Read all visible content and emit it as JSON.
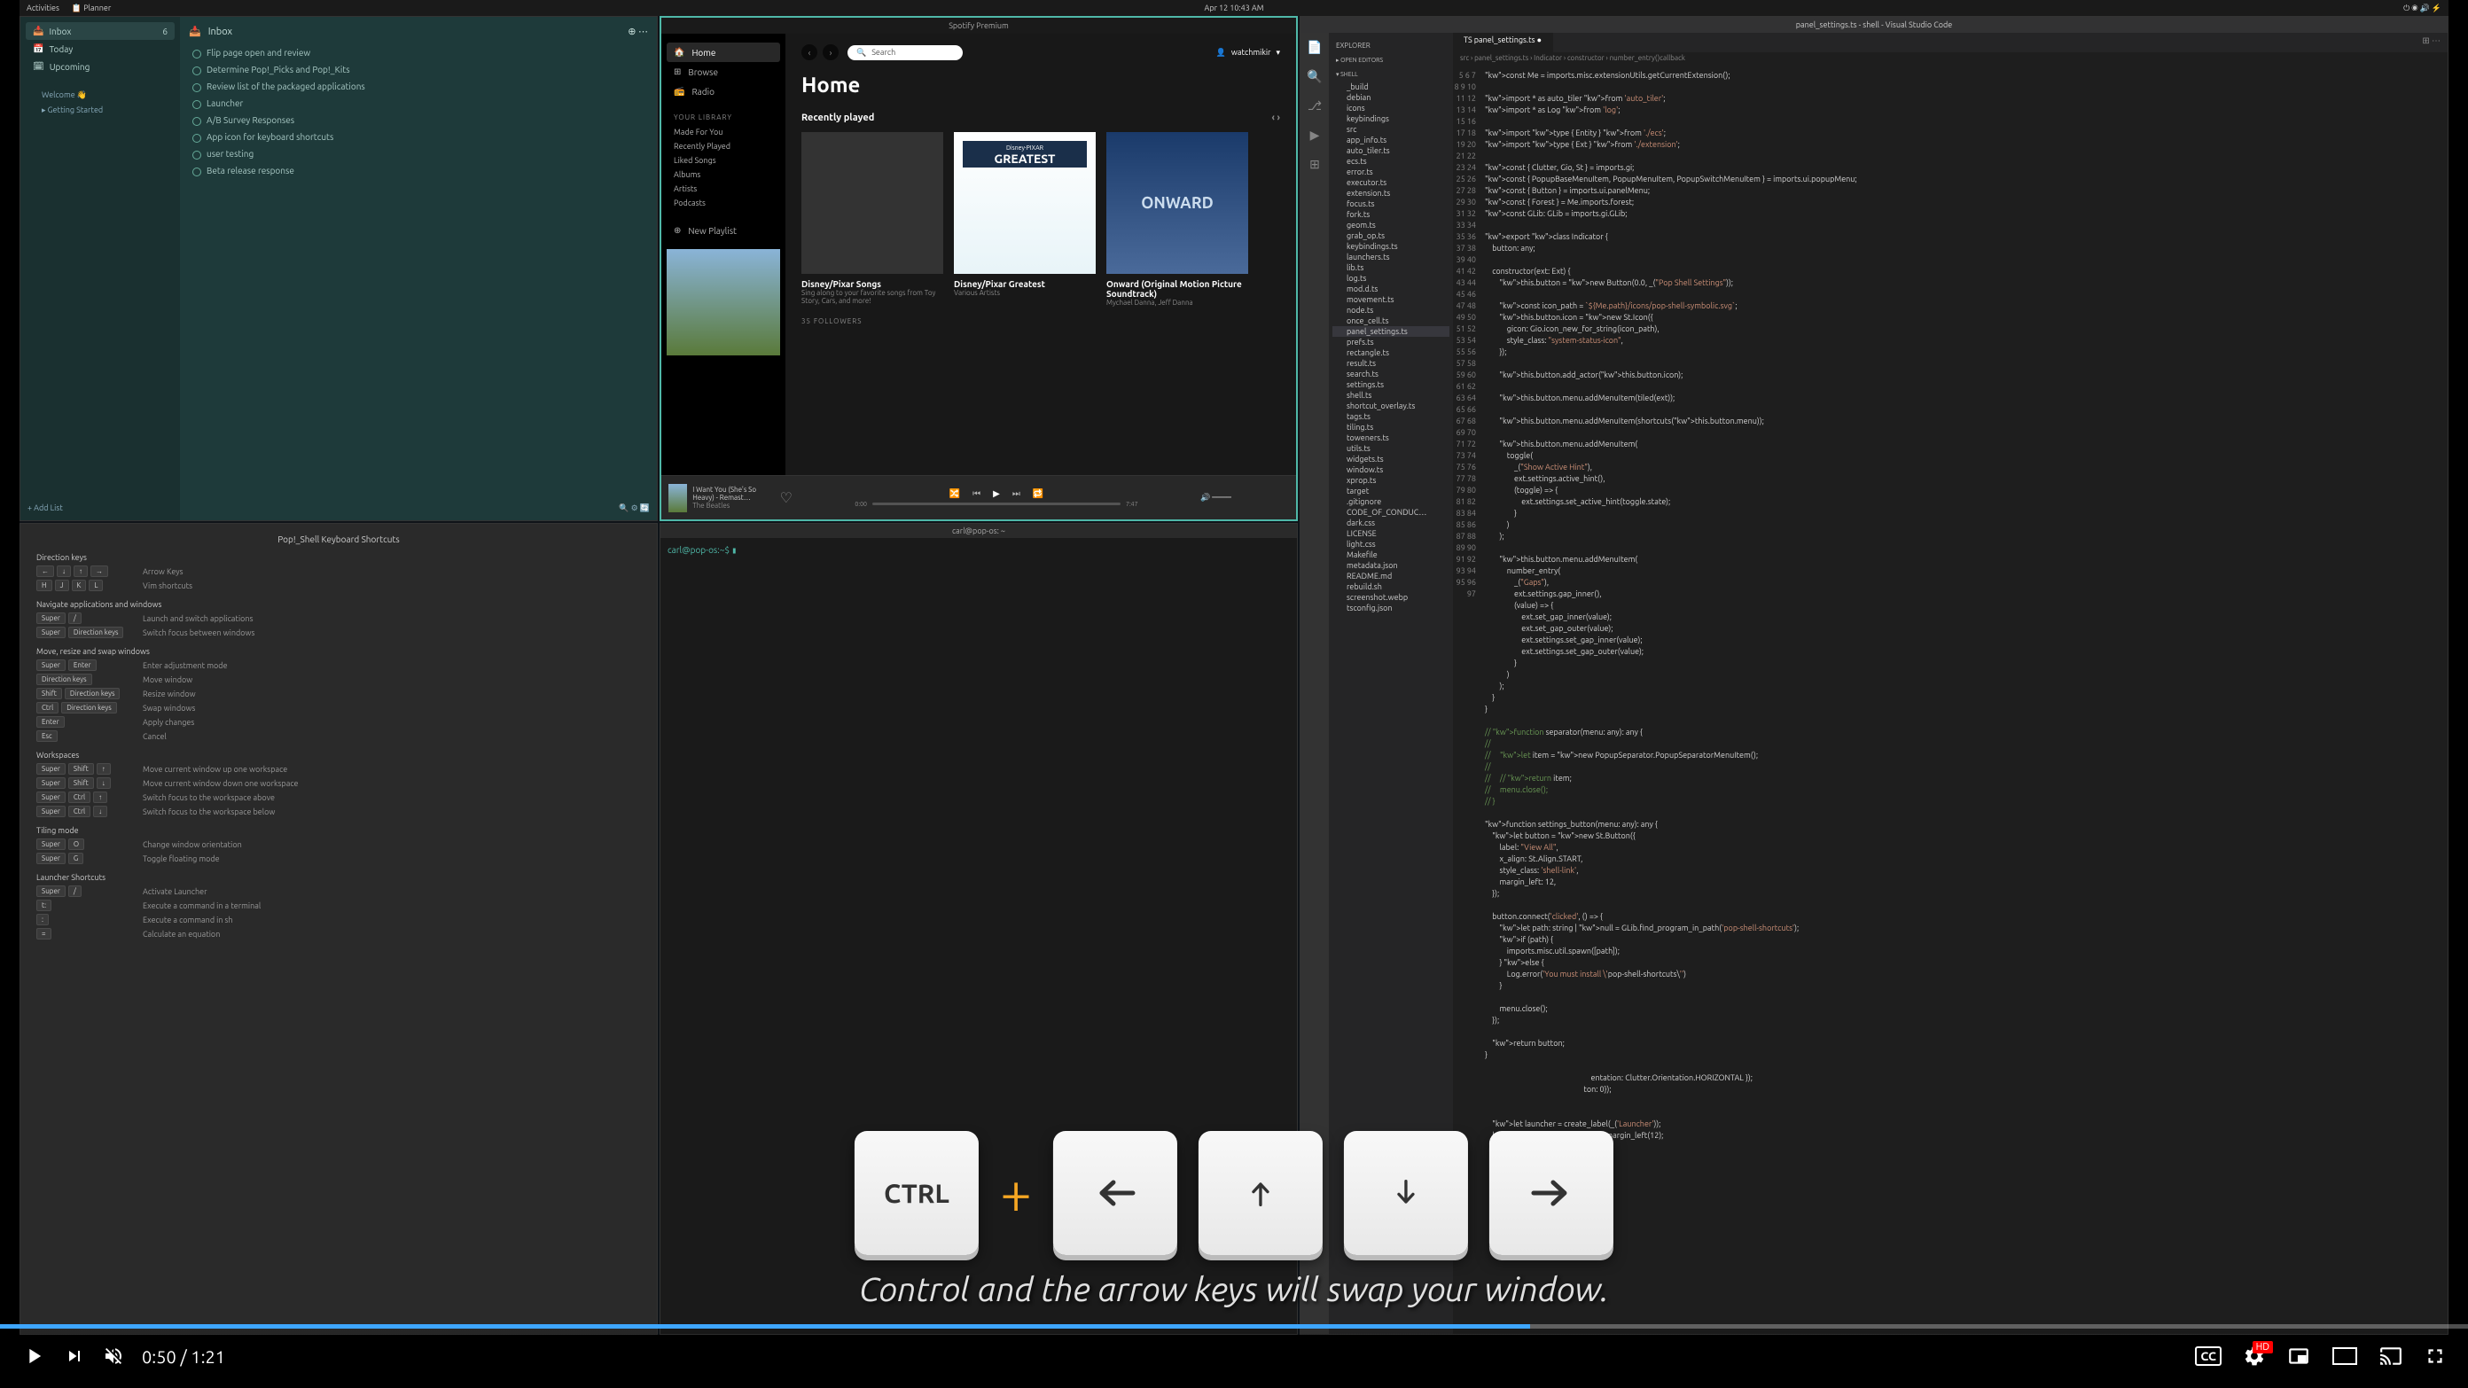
{
  "sysbar": {
    "activities": "Activities",
    "app": "Planner",
    "datetime": "Apr 12  10:43 AM"
  },
  "planner": {
    "sidebar": {
      "inbox": "Inbox",
      "inbox_count": "6",
      "today": "Today",
      "upcoming": "Upcoming",
      "projects_hdr": "",
      "projects": [
        "Welcome 👋",
        "Getting Started"
      ],
      "add": "+  Add List"
    },
    "header": "Inbox",
    "tasks": [
      "Flip page open and review",
      "Determine Pop!_Picks and Pop!_Kits",
      "Review list of the packaged applications",
      "Launcher",
      "A/B Survey Responses",
      "App icon for keyboard shortcuts",
      "user testing",
      "Beta release response"
    ]
  },
  "spotify": {
    "title": "Spotify Premium",
    "nav": {
      "home": "Home",
      "browse": "Browse",
      "radio": "Radio"
    },
    "search_placeholder": "Search",
    "user": "watchmikir",
    "library_hdr": "YOUR LIBRARY",
    "library": [
      "Made For You",
      "Recently Played",
      "Liked Songs",
      "Albums",
      "Artists",
      "Podcasts"
    ],
    "new_playlist": "New Playlist",
    "home_hdr": "Home",
    "recent_hdr": "Recently played",
    "cards": [
      {
        "title": "Disney/Pixar Songs",
        "desc": "Sing along to your favorite songs from Toy Story, Cars, and more!"
      },
      {
        "title": "Disney/Pixar Greatest",
        "desc": "Various Artists"
      },
      {
        "title": "Onward (Original Motion Picture Soundtrack)",
        "desc": "Mychael Danna, Jeff Danna"
      }
    ],
    "followers": "35 FOLLOWERS",
    "now_playing": {
      "track": "I Want You (She's So Heavy) - Remast…",
      "artist": "The Beatles"
    },
    "time_cur": "0:00",
    "time_tot": "7:47"
  },
  "vscode": {
    "title": "panel_settings.ts - shell - Visual Studio Code",
    "tab": "panel_settings.ts",
    "breadcrumb": "src › panel_settings.ts › Indicator › constructor › number_entry()callback",
    "explorer_hdr": "EXPLORER",
    "open_editors": "OPEN EDITORS",
    "root": "SHELL",
    "files": [
      "_build",
      "debian",
      "icons",
      "keybindings",
      "src",
      "app_info.ts",
      "auto_tiler.ts",
      "ecs.ts",
      "error.ts",
      "executor.ts",
      "extension.ts",
      "focus.ts",
      "fork.ts",
      "geom.ts",
      "grab_op.ts",
      "keybindings.ts",
      "launchers.ts",
      "lib.ts",
      "log.ts",
      "mod.d.ts",
      "movement.ts",
      "node.ts",
      "once_cell.ts",
      "panel_settings.ts",
      "prefs.ts",
      "rectangle.ts",
      "result.ts",
      "search.ts",
      "settings.ts",
      "shell.ts",
      "shortcut_overlay.ts",
      "tags.ts",
      "tiling.ts",
      "toweners.ts",
      "utils.ts",
      "widgets.ts",
      "window.ts",
      "xprop.ts",
      "target",
      ".gitignore",
      "CODE_OF_CONDUC…",
      "dark.css",
      "LICENSE",
      "light.css",
      "Makefile",
      "metadata.json",
      "README.md",
      "rebuild.sh",
      "screenshot.webp",
      "tsconfig.json"
    ],
    "selected_file": "panel_settings.ts",
    "code": "const Me = imports.misc.extensionUtils.getCurrentExtension();\n\nimport * as auto_tiler from 'auto_tiler';\nimport * as Log from 'log';\n\nimport type { Entity } from './ecs';\nimport type { Ext } from './extension';\n\nconst { Clutter, Gio, St } = imports.gi;\nconst { PopupBaseMenuItem, PopupMenuItem, PopupSwitchMenuItem } = imports.ui.popupMenu;\nconst { Button } = imports.ui.panelMenu;\nconst { Forest } = Me.imports.forest;\nconst GLib: GLib = imports.gi.GLib;\n\nexport class Indicator {\n    button: any;\n\n    constructor(ext: Ext) {\n        this.button = new Button(0.0, _(\"Pop Shell Settings\"));\n\n        const icon_path = `${Me.path}/icons/pop-shell-symbolic.svg`;\n        this.button.icon = new St.Icon({\n            gicon: Gio.icon_new_for_string(icon_path),\n            style_class: \"system-status-icon\",\n        });\n\n        this.button.add_actor(this.button.icon);\n\n        this.button.menu.addMenuItem(tiled(ext));\n\n        this.button.menu.addMenuItem(shortcuts(this.button.menu));\n\n        this.button.menu.addMenuItem(\n            toggle(\n                _(\"Show Active Hint\"),\n                ext.settings.active_hint(),\n                (toggle) => {\n                    ext.settings.set_active_hint(toggle.state);\n                }\n            )\n        );\n\n        this.button.menu.addMenuItem(\n            number_entry(\n                _(\"Gaps\"),\n                ext.settings.gap_inner(),\n                (value) => {\n                    ext.set_gap_inner(value);\n                    ext.set_gap_outer(value);\n                    ext.settings.set_gap_inner(value);\n                    ext.settings.set_gap_outer(value);\n                }\n            )\n        );\n    }\n}\n\n// function separator(menu: any): any {\n//\n//     let item = new PopupSeparator.PopupSeparatorMenuItem();\n//\n//     // return item;\n//     menu.close();\n// }\n\nfunction settings_button(menu: any): any {\n    let button = new St.Button({\n        label: \"View All\",\n        x_align: St.Align.START,\n        style_class: 'shell-link',\n        margin_left: 12,\n    });\n\n    button.connect('clicked', () => {\n        let path: string | null = GLib.find_program_in_path('pop-shell-shortcuts');\n        if (path) {\n            imports.misc.util.spawn([path]);\n        } else {\n            Log.error('You must install \\'pop-shell-shortcuts\\'')\n        }\n\n        menu.close();\n    });\n\n    return button;\n}\n\n                                                          entation: Clutter.Orientation.HORIZONTAL });\n                                                      ton: 0});\n\n\n    let launcher = create_label(_('Launcher'));\n    launcher.get_clutter_text().set_margin_left(12);"
  },
  "shortcuts": {
    "title": "Pop!_Shell Keyboard Shortcuts",
    "sections": [
      {
        "hdr": "Direction keys",
        "rows": [
          {
            "keys": [
              "←",
              "↓",
              "↑",
              "→"
            ],
            "desc": "Arrow Keys"
          },
          {
            "keys": [
              "H",
              "J",
              "K",
              "L"
            ],
            "desc": "Vim shortcuts"
          }
        ]
      },
      {
        "hdr": "Navigate applications and windows",
        "rows": [
          {
            "keys": [
              "Super",
              "/"
            ],
            "desc": "Launch and switch applications"
          },
          {
            "keys": [
              "Super",
              "Direction keys"
            ],
            "desc": "Switch focus between windows"
          }
        ]
      },
      {
        "hdr": "Move, resize and swap windows",
        "rows": [
          {
            "keys": [
              "Super",
              "Enter"
            ],
            "desc": "Enter adjustment mode"
          },
          {
            "keys": [
              "Direction keys"
            ],
            "desc": "Move window"
          },
          {
            "keys": [
              "Shift",
              "Direction keys"
            ],
            "desc": "Resize window"
          },
          {
            "keys": [
              "Ctrl",
              "Direction keys"
            ],
            "desc": "Swap windows"
          },
          {
            "keys": [
              "Enter"
            ],
            "desc": "Apply changes"
          },
          {
            "keys": [
              "Esc"
            ],
            "desc": "Cancel"
          }
        ]
      },
      {
        "hdr": "Workspaces",
        "rows": [
          {
            "keys": [
              "Super",
              "Shift",
              "↑"
            ],
            "desc": "Move current window up one workspace"
          },
          {
            "keys": [
              "Super",
              "Shift",
              "↓"
            ],
            "desc": "Move current window down one workspace"
          },
          {
            "keys": [
              "Super",
              "Ctrl",
              "↑"
            ],
            "desc": "Switch focus to the workspace above"
          },
          {
            "keys": [
              "Super",
              "Ctrl",
              "↓"
            ],
            "desc": "Switch focus to the workspace below"
          }
        ]
      },
      {
        "hdr": "Tiling mode",
        "rows": [
          {
            "keys": [
              "Super",
              "O"
            ],
            "desc": "Change window orientation"
          },
          {
            "keys": [
              "Super",
              "G"
            ],
            "desc": "Toggle floating mode"
          }
        ]
      },
      {
        "hdr": "Launcher Shortcuts",
        "rows": [
          {
            "keys": [
              "Super",
              "/"
            ],
            "desc": "Activate Launcher"
          },
          {
            "keys": [
              "t:"
            ],
            "desc": "Execute a command in a terminal"
          },
          {
            "keys": [
              ":"
            ],
            "desc": "Execute a command in sh"
          },
          {
            "keys": [
              "="
            ],
            "desc": "Calculate an equation"
          }
        ]
      }
    ]
  },
  "terminal": {
    "title": "carl@pop-os: ~",
    "prompt": "carl@pop-os:~$ "
  },
  "overlay": {
    "ctrl": "CTRL",
    "caption": "Control and the arrow keys will swap your window."
  },
  "player": {
    "current": "0:50",
    "total": "1:21",
    "hd": "HD"
  }
}
